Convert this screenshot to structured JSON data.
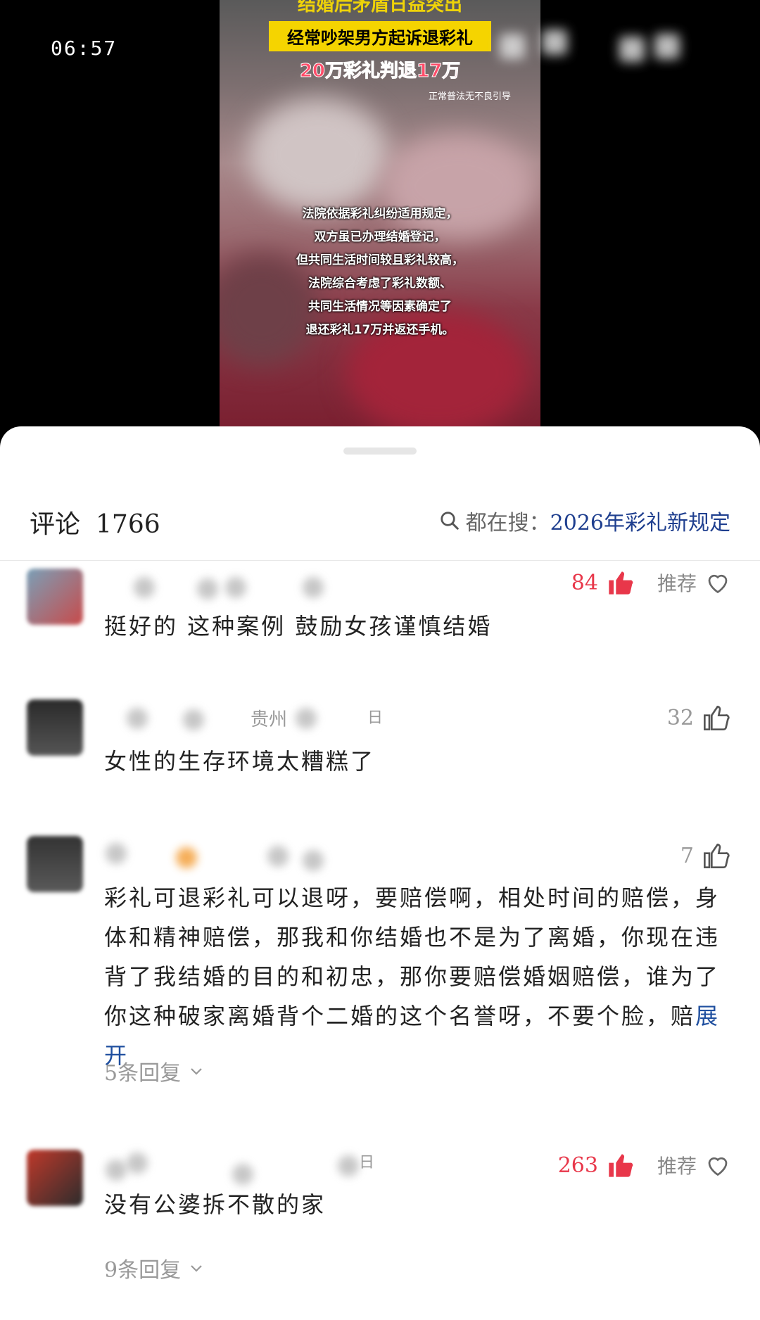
{
  "status": {
    "time": "06:57"
  },
  "video": {
    "title_line1": "结婚后矛盾日益突出",
    "title_line2": "经常吵架男方起诉退彩礼",
    "title_line3": "20万彩礼判退17万",
    "note": "正常普法无不良引导",
    "subtitle": [
      "法院依据彩礼纠纷适用规定，",
      "双方虽已办理结婚登记，",
      "但共同生活时间较且彩礼较高，",
      "法院综合考虑了彩礼数额、",
      "共同生活情况等因素确定了",
      "退还彩礼17万并返还手机。"
    ]
  },
  "comments_header": {
    "label": "评论",
    "count": "1766",
    "search_prefix": "都在搜：",
    "search_keyword": "2026年彩礼新规定"
  },
  "comments": [
    {
      "text": "挺好的 这种案例 鼓励女孩谨慎结婚",
      "likes": "84",
      "hot": true,
      "recommend": "推荐"
    },
    {
      "location": "贵州",
      "day": "日",
      "text": "女性的生存环境太糟糕了",
      "likes": "32"
    },
    {
      "text": "彩礼可退彩礼可以退呀，要赔偿啊，相处时间的赔偿，身体和精神赔偿，那我和你结婚也不是为了离婚，你现在违背了我结婚的目的和初忠，那你要赔偿婚姻赔偿，谁为了你这种破家离婚背个二婚的这个名誉呀，不要个脸，赔",
      "expand": "展开",
      "likes": "7",
      "replies": "5条回复"
    },
    {
      "day": "日",
      "text": "没有公婆拆不散的家",
      "likes": "263",
      "hot": true,
      "recommend": "推荐",
      "replies": "9条回复"
    }
  ],
  "colors": {
    "hot_like": "#e8374a",
    "link": "#1f4f9f"
  }
}
